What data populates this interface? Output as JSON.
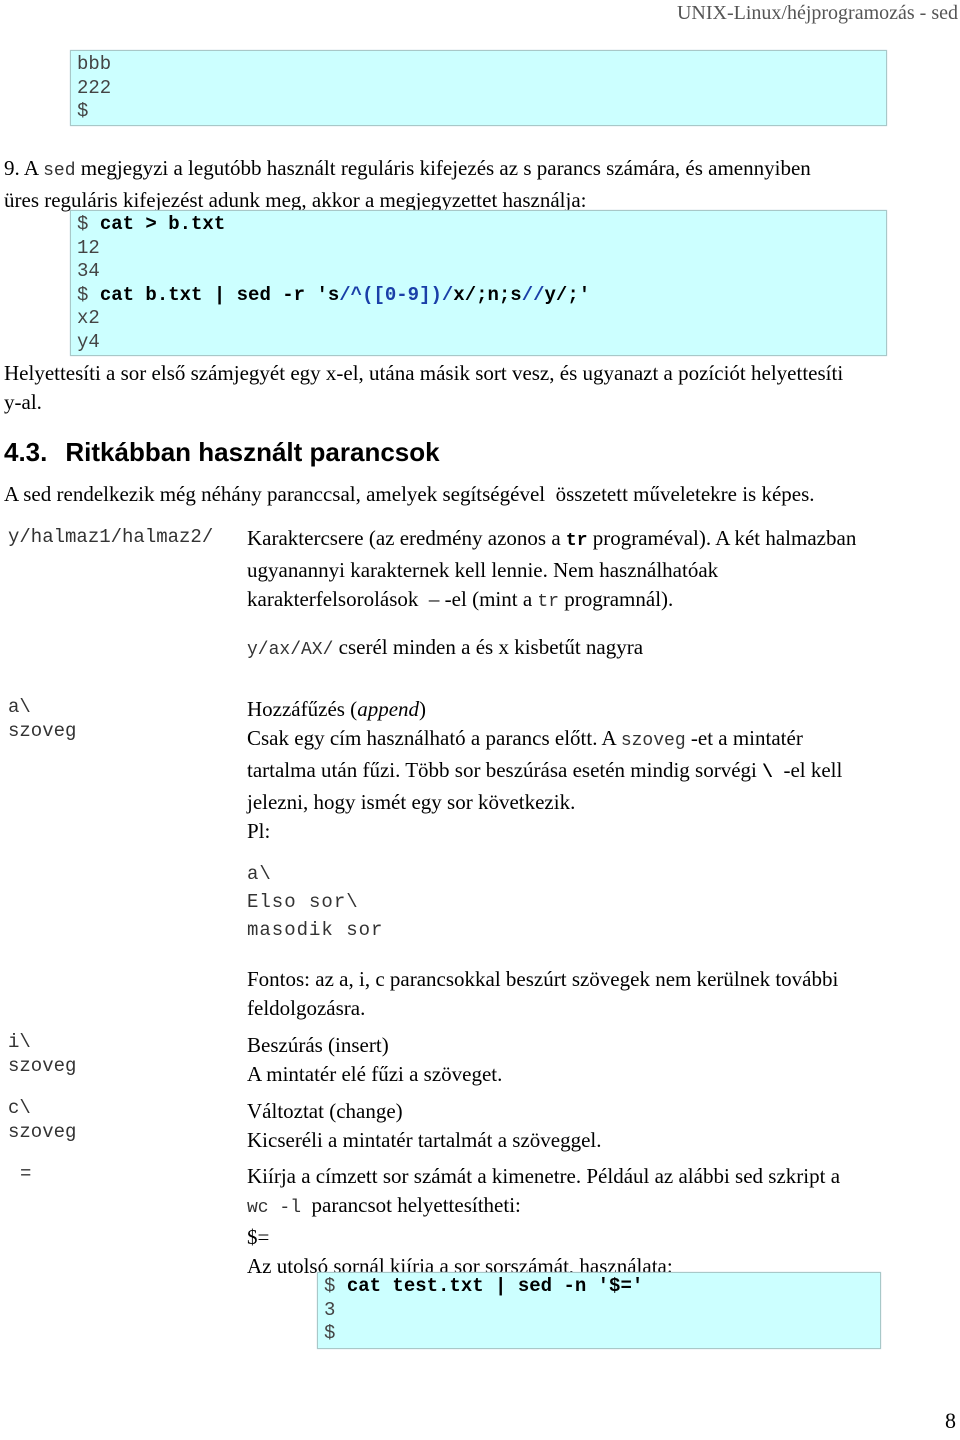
{
  "header": {
    "title": "UNIX-Linux/héjprogramozás - sed"
  },
  "code_block_1": {
    "lines": [
      "bbb",
      "222",
      "$"
    ]
  },
  "item9": {
    "number": "9. A ",
    "sed": "sed",
    "text_1": " megjegyzi a legutóbb használt reguláris kifejezés az s parancs számára, és amennyiben",
    "text_2": "üres reguláris kifejezést adunk meg, akkor a megjegyzettet használja:"
  },
  "code_block_2": {
    "line1_prompt": "$ ",
    "line1_cmd": "cat > b.txt",
    "line2": "12",
    "line3": "34",
    "line4_prompt": "$ ",
    "line4_a": "cat b.txt | sed -r 's",
    "line4_b": "/^([0-9])/",
    "line4_c": "x/;n;s",
    "line4_d": "//",
    "line4_e": "y/;'",
    "line5": "x2",
    "line6": "y4"
  },
  "explanation": {
    "line1": "Helyettesíti a sor első számjegyét egy x-el, utána másik sort vesz, és ugyanazt a pozíciót helyettesíti",
    "line2": "y-al."
  },
  "section": {
    "number": "4.3.",
    "title": "Ritkábban használt parancsok",
    "intro": "A sed rendelkezik még néhány paranccsal, amelyek segítségével  összetett műveletekre is képes."
  },
  "commands": {
    "y": {
      "syntax": "y/halmaz1/halmaz2/",
      "desc_1a": "Karaktercsere (az eredmény azonos a ",
      "desc_1code": "tr",
      "desc_1b": " programéval). A két halmazban",
      "desc_2": "ugyanannyi karakternek kell lennie. Nem használhatóak",
      "desc_3a": "karakterfelsorolások  – -el (mint a ",
      "desc_3code": "tr",
      "desc_3b": " programnál).",
      "example_code": "y/ax/AX/",
      "example_text": " cserél minden a és x kisbetűt nagyra"
    },
    "a": {
      "syntax_1": "a\\",
      "syntax_2": "szoveg",
      "title_a": "Hozzáfűzés (",
      "title_italic": "append",
      "title_b": ")",
      "desc_1a": "Csak egy cím használható a parancs előtt. A ",
      "desc_1code": "szoveg",
      "desc_1b": " -et a mintatér",
      "desc_2a": "tartalma után fűzi. Több sor beszúrása esetén mindig sorvégi ",
      "desc_2code": "\\",
      "desc_2b": "  -el kell",
      "desc_3": "jelezni, hogy ismét egy sor következik.",
      "desc_4": "Pl:",
      "example": [
        "a\\",
        "Elso sor\\",
        "masodik sor"
      ],
      "note_1": "Fontos: az a, i, c parancsokkal beszúrt szövegek nem kerülnek további",
      "note_2": "feldolgozásra."
    },
    "i": {
      "syntax_1": "i\\",
      "syntax_2": "szoveg",
      "title": "Beszúrás (insert)",
      "desc": "A mintatér elé fűzi a szöveget."
    },
    "c": {
      "syntax_1": "c\\",
      "syntax_2": "szoveg",
      "title": "Változtat (change)",
      "desc": "Kicseréli a mintatér tartalmát a szöveggel."
    },
    "eq": {
      "syntax": "=",
      "desc_1": "Kiírja a címzett sor számát a kimenetre. Például az alábbi sed szkript a",
      "desc_2code": "wc -l",
      "desc_2b": "  parancsot helyettesítheti:",
      "desc_3": "$=",
      "desc_4": "Az utolsó sornál kiírja a sor sorszámát, használata:"
    }
  },
  "code_block_3": {
    "line1_prompt": "$ ",
    "line1_cmd": "cat test.txt | sed -n '$='",
    "line2": "3",
    "line3": "$"
  },
  "footer": {
    "page_number": "8"
  }
}
